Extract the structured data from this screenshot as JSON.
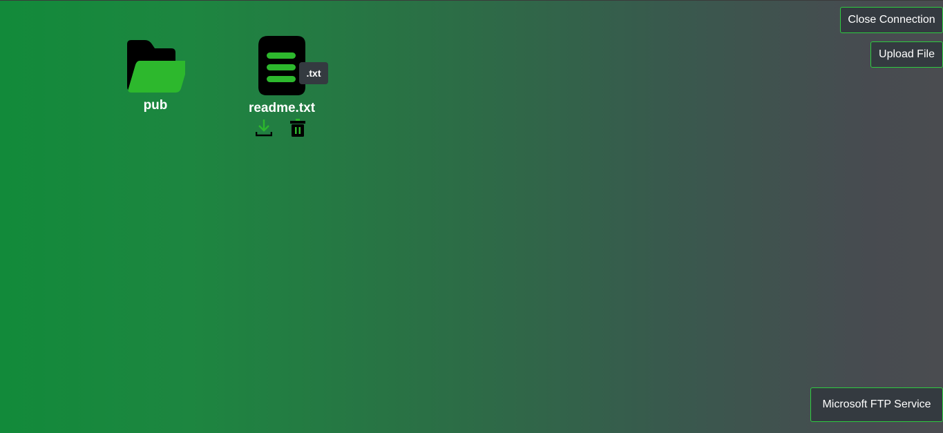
{
  "toolbar": {
    "close_connection_label": "Close Connection",
    "upload_file_label": "Upload File"
  },
  "server": {
    "banner": "Microsoft FTP Service"
  },
  "files": [
    {
      "name": "pub",
      "type": "folder",
      "icon": "folder-open-icon"
    },
    {
      "name": "readme.txt",
      "type": "file",
      "extension": ".txt",
      "icon": "file-text-icon",
      "actions": [
        "download-icon",
        "trash-icon"
      ]
    }
  ],
  "colors": {
    "accent": "#2ecc40",
    "button_bg": "#343a40",
    "icon_dark": "#000000",
    "icon_green": "#2db82d"
  }
}
